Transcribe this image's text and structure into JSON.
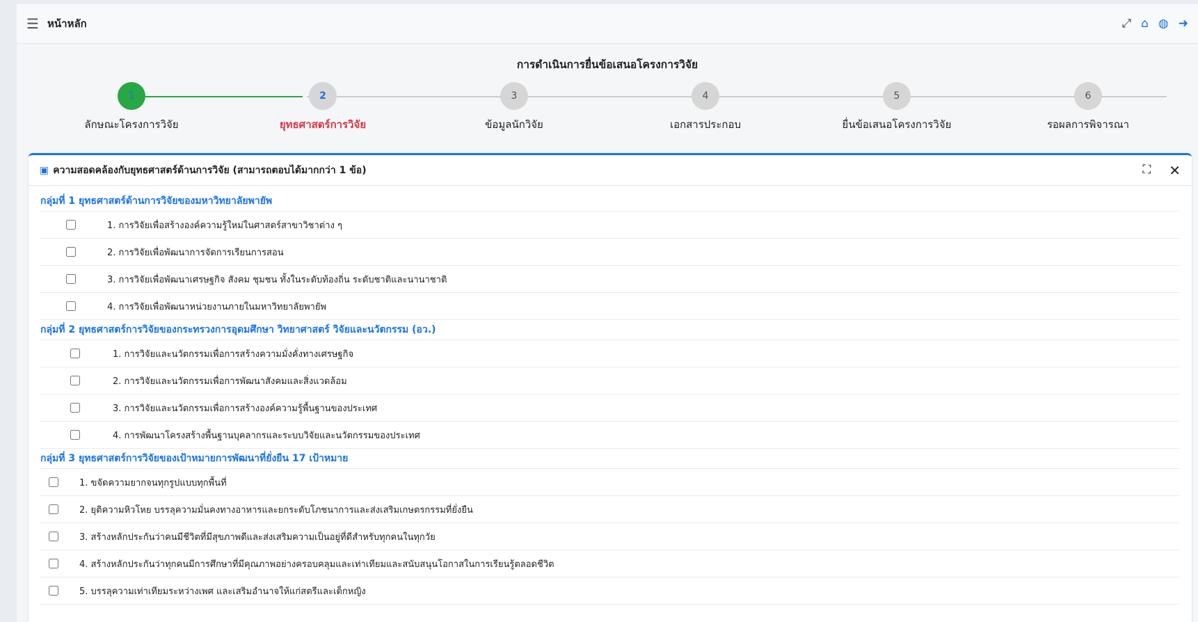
{
  "topbar": {
    "menu_icon": "hamburger-icon",
    "title": "หน้าหลัก",
    "icons": [
      "expand-icon",
      "home-icon",
      "globe-icon",
      "sign-out-icon"
    ]
  },
  "wizard": {
    "title": "การดำเนินการยื่นข้อเสนอโครงการวิจัย",
    "steps": [
      {
        "number": "1",
        "label": "ลักษณะโครงการวิจัย",
        "state": "done"
      },
      {
        "number": "2",
        "label": "ยุทธศาสตร์การวิจัย",
        "state": "current"
      },
      {
        "number": "3",
        "label": "ข้อมูลนักวิจัย",
        "state": "todo"
      },
      {
        "number": "4",
        "label": "เอกสารประกอบ",
        "state": "todo"
      },
      {
        "number": "5",
        "label": "ยื่นข้อเสนอโครงการวิจัย",
        "state": "todo"
      },
      {
        "number": "6",
        "label": "รอผลการพิจารณา",
        "state": "todo"
      }
    ],
    "colors": {
      "done": "#28a745",
      "current_label": "#dc3545",
      "number": "#1a73e8"
    }
  },
  "card": {
    "title": "ความสอดคล้องกับยุทธศาสตร์ด้านการวิจัย (สามารถตอบได้มากกว่า 1 ข้อ)",
    "header_icon": "book-icon",
    "tools": [
      "maximize-icon",
      "close-icon"
    ],
    "groups": [
      {
        "title": "กลุ่มที่ 1 ยุทธศาสตร์ด้านการวิจัยของมหาวิทยาลัยพายัพ",
        "items": [
          "1. การวิจัยเพื่อสร้างองค์ความรู้ใหม่ในศาสตร์สาขาวิชาต่าง ๆ",
          "2. การวิจัยเพื่อพัฒนาการจัดการเรียนการสอน",
          "3. การวิจัยเพื่อพัฒนาเศรษฐกิจ สังคม ชุมชน ทั้งในระดับท้องถิ่น ระดับชาติและนานาชาติ",
          "4. การวิจัยเพื่อพัฒนาหน่วยงานภายในมหาวิทยาลัยพายัพ"
        ]
      },
      {
        "title": "กลุ่มที่ 2 ยุทธศาสตร์การวิจัยของกระทรวงการอุดมศึกษา วิทยาศาสตร์ วิจัยและนวัตกรรม (อว.)",
        "items": [
          "1. การวิจัยและนวัตกรรมเพื่อการสร้างความมั่งคั่งทางเศรษฐกิจ",
          "2. การวิจัยและนวัตกรรมเพื่อการพัฒนาสังคมและสิ่งแวดล้อม",
          "3. การวิจัยและนวัตกรรมเพื่อการสร้างองค์ความรู้พื้นฐานของประเทศ",
          "4. การพัฒนาโครงสร้างพื้นฐานบุคลากรและระบบวิจัยและนวัตกรรมของประเทศ"
        ]
      },
      {
        "title": "กลุ่มที่ 3 ยุทธศาสตร์การวิจัยของเป้าหมายการพัฒนาที่ยั่งยืน 17 เป้าหมาย",
        "items": [
          "1. ขจัดความยากจนทุกรูปแบบทุกพื้นที่",
          "2. ยุติความหิวโหย บรรลุความมั่นคงทางอาหารและยกระดับโภชนาการและส่งเสริมเกษตรกรรมที่ยั่งยืน",
          "3. สร้างหลักประกันว่าคนมีชีวิตที่มีสุขภาพดีและส่งเสริมความเป็นอยู่ที่ดีสำหรับทุกคนในทุกวัย",
          "4. สร้างหลักประกันว่าทุกคนมีการศึกษาที่มีคุณภาพอย่างครอบคลุมและเท่าเทียมและสนับสนุนโอกาสในการเรียนรู้ตลอดชีวิต",
          "5. บรรลุความเท่าเทียมระหว่างเพศ และเสริมอำนาจให้แก่สตรีและเด็กหญิง"
        ]
      }
    ]
  }
}
